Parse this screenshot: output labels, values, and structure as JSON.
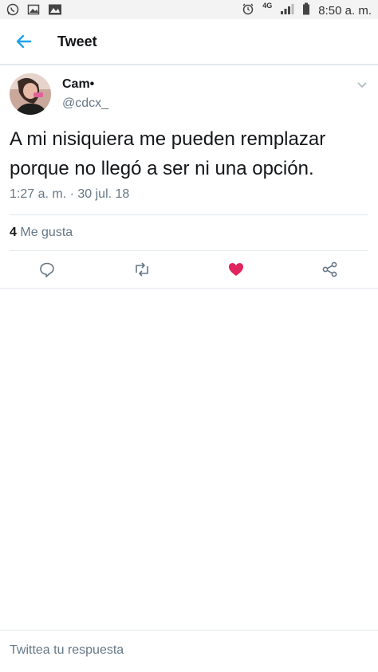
{
  "status_bar": {
    "network": "4G",
    "time": "8:50 a. m."
  },
  "header": {
    "title": "Tweet"
  },
  "tweet": {
    "author_name": "Cam•",
    "author_handle": "@cdcx_",
    "text": "A mi nisiquiera me pueden remplazar porque no llegó a ser ni una opción.",
    "timestamp": "1:27 a. m. · 30 jul. 18",
    "like_count": "4",
    "like_label": "Me gusta"
  },
  "reply": {
    "placeholder": "Twittea tu respuesta"
  },
  "colors": {
    "accent": "#1da1f2",
    "like_red": "#e0245e",
    "secondary_text": "#657786",
    "divider": "#e1e8ed"
  },
  "icons": {
    "back": "arrow-left-icon",
    "reply": "reply-icon",
    "retweet": "retweet-icon",
    "like": "heart-icon",
    "share": "share-icon",
    "more": "chevron-down-icon"
  }
}
